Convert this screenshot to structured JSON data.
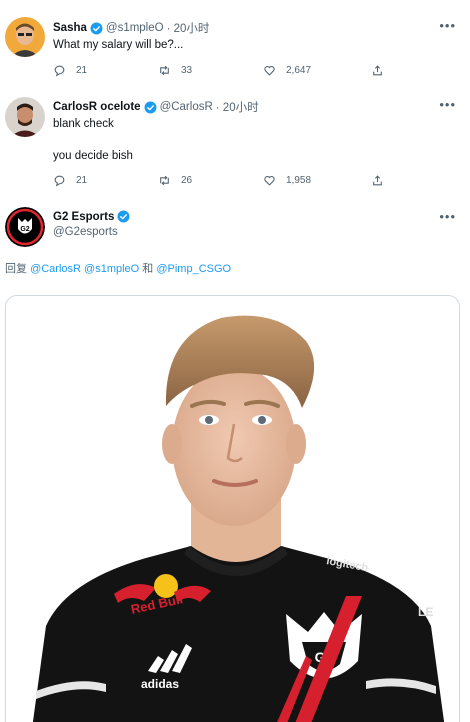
{
  "tweets": [
    {
      "name": "Sasha",
      "handle": "@s1mpleO",
      "time": "· 20小时",
      "text": [
        "What my salary will be?..."
      ],
      "replies": "21",
      "retweets": "33",
      "likes": "2,647"
    },
    {
      "name": "CarlosR ocelote",
      "handle": "@CarlosR",
      "time": "· 20小时",
      "text": [
        "blank check",
        "you decide bish"
      ],
      "replies": "21",
      "retweets": "26",
      "likes": "1,958"
    },
    {
      "name": "G2 Esports",
      "handle": "@G2esports"
    }
  ],
  "reply_to": {
    "prefix": "回复",
    "mention1": "@CarlosR",
    "mention2": "@s1mpleO",
    "conj": "和",
    "mention3": "@Pimp_CSGO"
  },
  "media": {
    "jersey_sponsor": "Red Bull",
    "jersey_brand": "adidas",
    "jersey_partner": "logitech",
    "jersey_side": "LE"
  },
  "icons": {
    "more": "more-horizontal-icon",
    "reply": "reply-icon",
    "retweet": "retweet-icon",
    "like": "heart-icon",
    "share": "share-icon"
  },
  "colors": {
    "verified": "#1d9bf0",
    "secondary_text": "#536471",
    "link": "#1d9bf0"
  }
}
